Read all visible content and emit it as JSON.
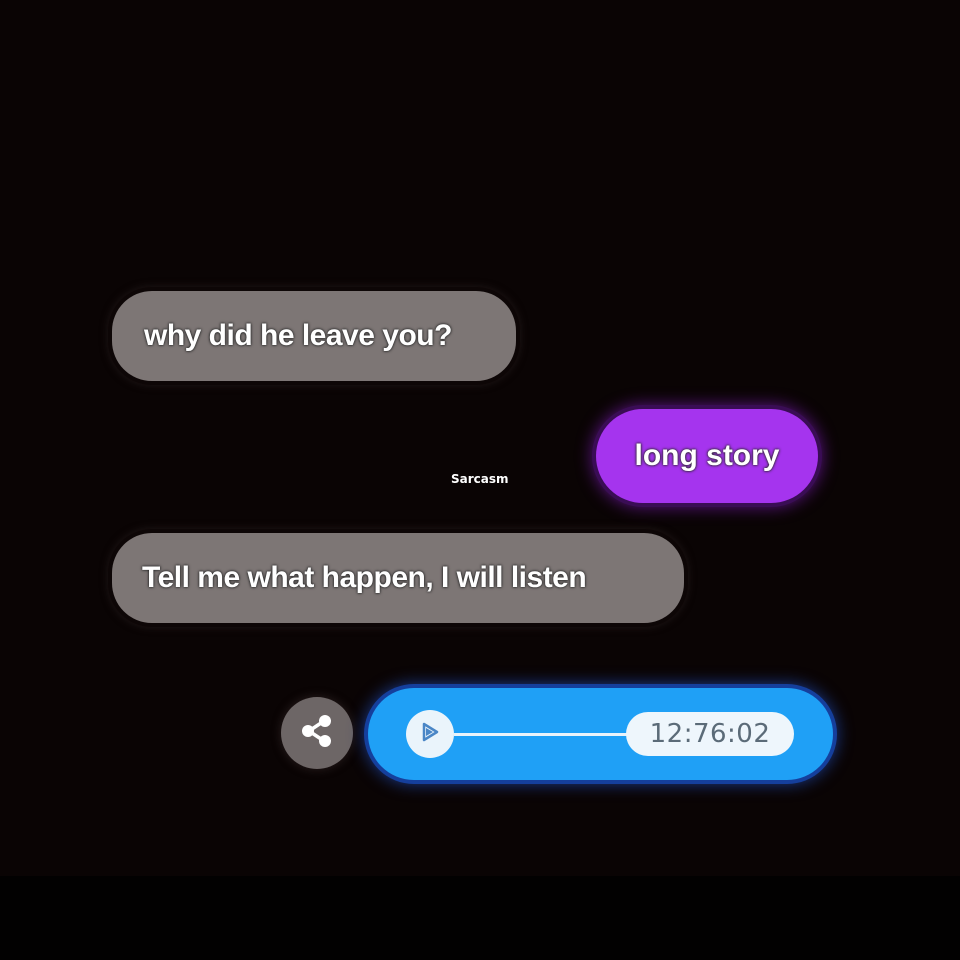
{
  "conversation": {
    "messages": [
      {
        "direction": "received",
        "text": "why did he leave you?"
      },
      {
        "direction": "sent",
        "text": "long story"
      },
      {
        "direction": "received",
        "text": "Tell me what happen, I will listen"
      }
    ],
    "voice_message": {
      "duration": "12:76:02",
      "play_icon": "play-icon",
      "share_icon": "share-icon"
    }
  },
  "watermark": "Sarcasm",
  "colors": {
    "background": "#0a0404",
    "received_bubble": "#7d7675",
    "sent_bubble": "#a534ee",
    "voice_bubble": "#1fa0f6",
    "share_button": "#6d6666"
  }
}
